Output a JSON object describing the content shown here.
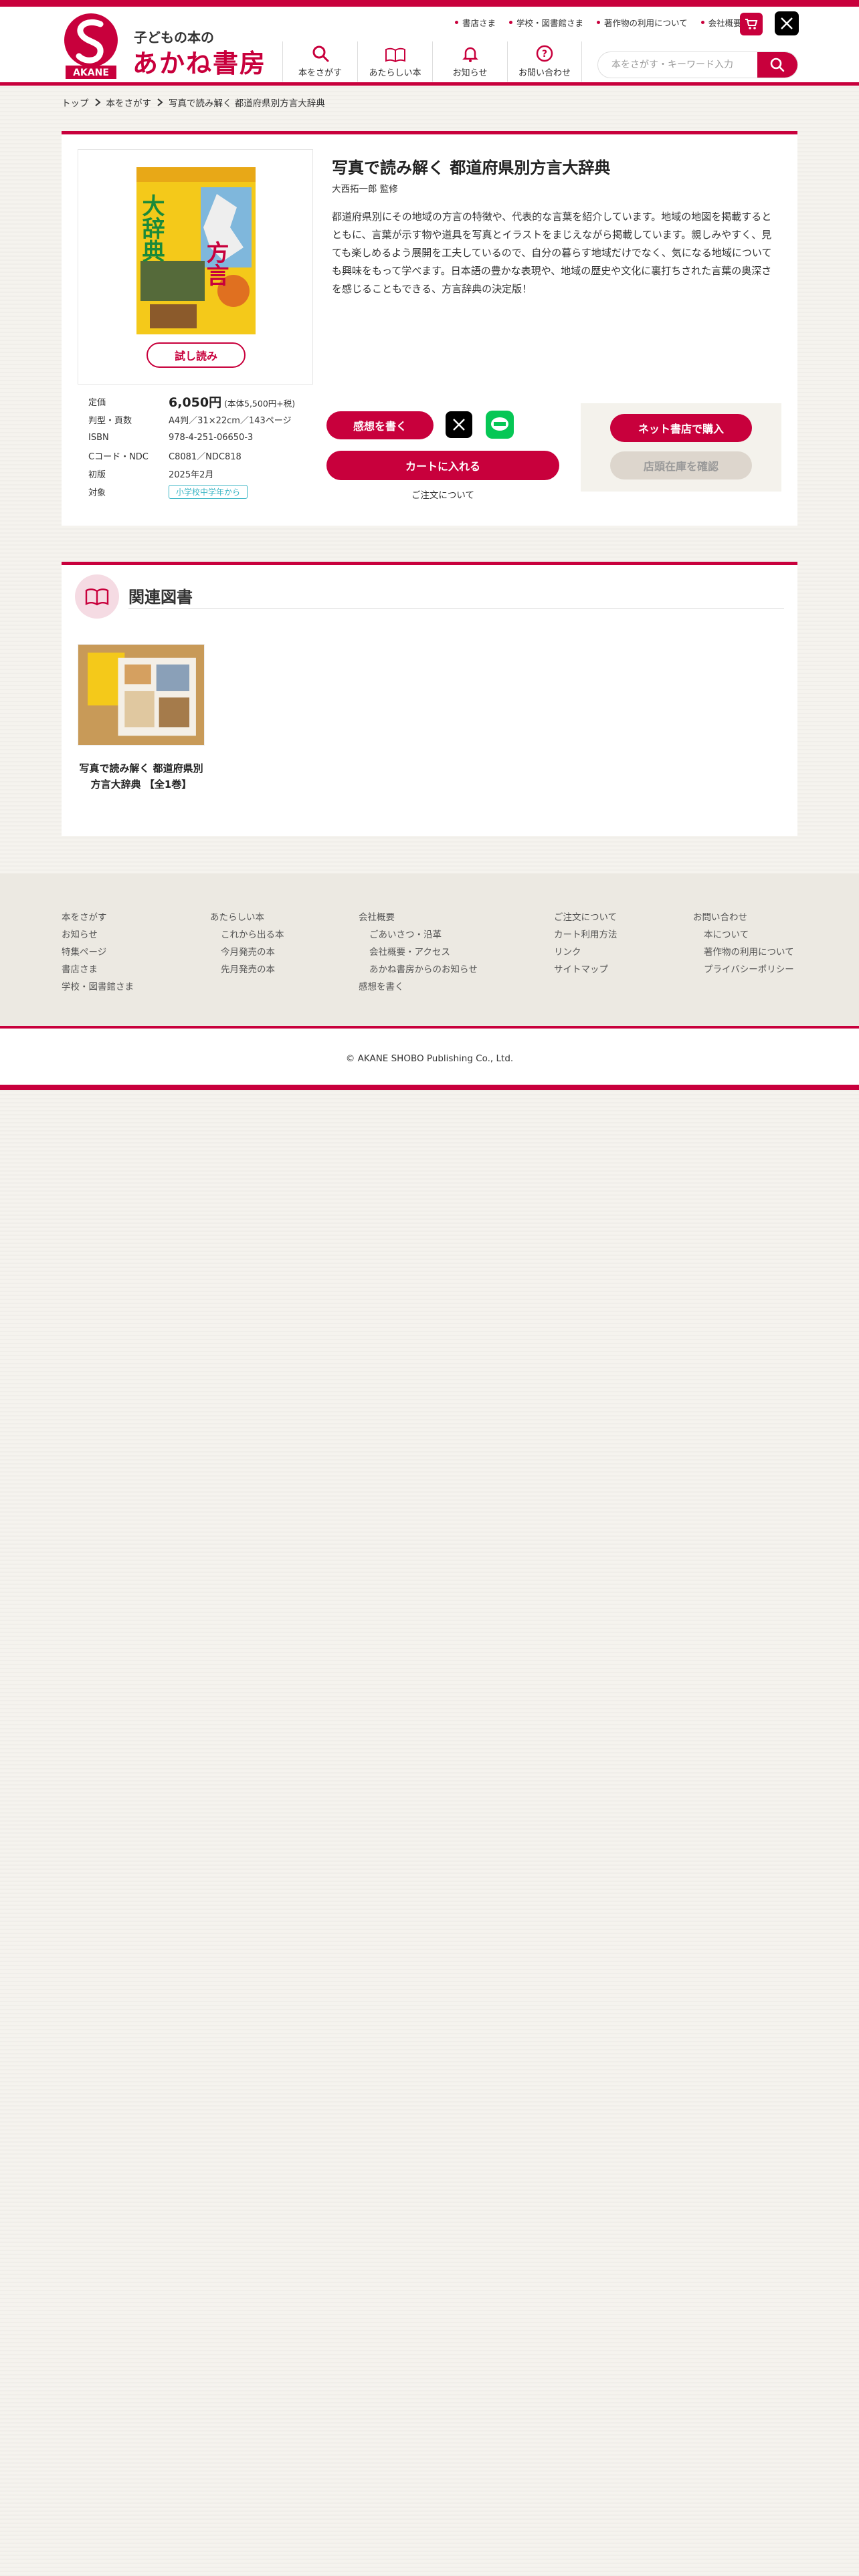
{
  "brand": {
    "sub": "子どもの本の",
    "name": "あかね書房",
    "mark_text": "AKANE",
    "primary_color": "#c8003c"
  },
  "utility_nav": [
    {
      "label": "書店さま"
    },
    {
      "label": "学校・図書館さま"
    },
    {
      "label": "著作物の利用について"
    },
    {
      "label": "会社概要"
    }
  ],
  "global_nav": [
    {
      "label": "本をさがす",
      "icon": "search-icon"
    },
    {
      "label": "あたらしい本",
      "icon": "new-book-icon"
    },
    {
      "label": "お知らせ",
      "icon": "bell-icon"
    },
    {
      "label": "お問い合わせ",
      "icon": "question-icon"
    }
  ],
  "search": {
    "placeholder": "本をさがす・キーワード入力"
  },
  "breadcrumb": [
    "トップ",
    "本をさがす",
    "写真で読み解く 都道府県別方言大辞典"
  ],
  "book": {
    "title": "写真で読み解く 都道府県別方言大辞典",
    "author": "大西拓一郎 監修",
    "description": "都道府県別にその地域の方言の特徴や、代表的な言葉を紹介しています。地域の地図を掲載するとともに、言葉が示す物や道具を写真とイラストをまじえながら掲載しています。親しみやすく、見ても楽しめるよう展開を工夫しているので、自分の暮らす地域だけでなく、気になる地域についても興味をもって学べます。日本語の豊かな表現や、地域の歴史や文化に裏打ちされた言葉の奥深さを感じることもできる、方言辞典の決定版！",
    "cover_texts": {
      "big_left": "大辞典",
      "big_right": "方言"
    },
    "try_read": "試し読み",
    "specs": {
      "price_label": "定価",
      "price": "6,050円",
      "price_tax": "(本体5,500円+税)",
      "size_label": "判型・頁数",
      "size": "A4判／31×22cm／143ページ",
      "isbn_label": "ISBN",
      "isbn": "978-4-251-06650-3",
      "ccode_label": "Cコード・NDC",
      "ccode": "C8081／NDC818",
      "first_label": "初版",
      "first": "2025年2月",
      "target_label": "対象",
      "target": "小学校中学年から"
    }
  },
  "actions": {
    "review": "感想を書く",
    "cart": "カートに入れる",
    "order_about": "ご注文について",
    "net_buy": "ネット書店で購入",
    "store_stock": "店頭在庫を確認"
  },
  "related": {
    "heading": "関連図書",
    "items": [
      {
        "title": "写真で読み解く 都道府県別方言大辞典 【全1巻】"
      }
    ]
  },
  "footer": {
    "col1": [
      "本をさがす",
      "お知らせ",
      "特集ページ",
      "書店さま",
      "学校・図書館さま"
    ],
    "col2_head": "あたらしい本",
    "col2": [
      "これから出る本",
      "今月発売の本",
      "先月発売の本"
    ],
    "col3_head": "会社概要",
    "col3": [
      "ごあいさつ・沿革",
      "会社概要・アクセス",
      "あかね書房からのお知らせ"
    ],
    "col3_tail": "感想を書く",
    "col4": [
      "ご注文について",
      "カート利用方法",
      "リンク",
      "サイトマップ"
    ],
    "col5_head": "お問い合わせ",
    "col5": [
      "本について",
      "著作物の利用について",
      "プライバシーポリシー"
    ],
    "copyright": "© AKANE SHOBO Publishing Co., Ltd."
  }
}
